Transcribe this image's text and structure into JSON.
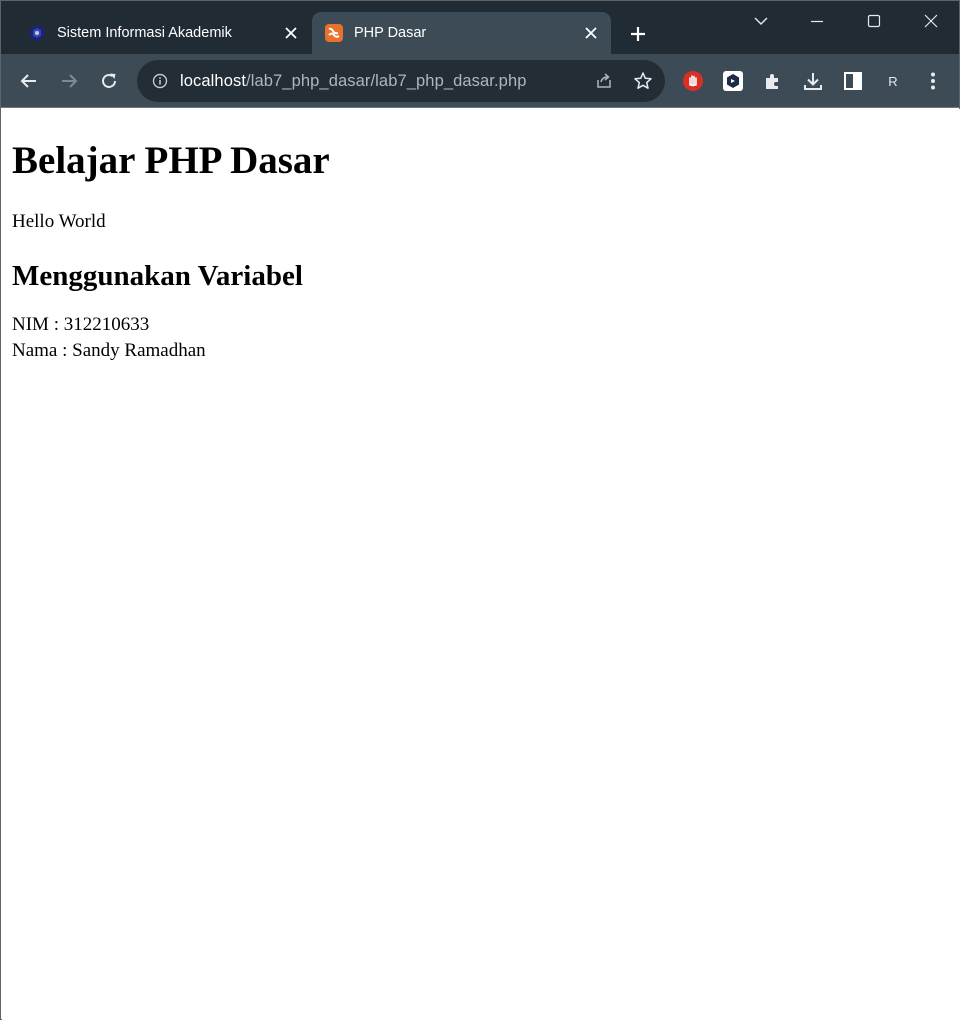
{
  "browser": {
    "tabs": [
      {
        "title": "Sistem Informasi Akademik",
        "favicon": "university-logo-icon",
        "active": false
      },
      {
        "title": "PHP Dasar",
        "favicon": "xampp-logo-icon",
        "active": true
      }
    ],
    "address_bar": {
      "host": "localhost",
      "path": "/lab7_php_dasar/lab7_php_dasar.php"
    },
    "profile_initial": "R",
    "colors": {
      "frame": "#202b34",
      "toolbar": "#3c4b55",
      "omnibox": "#222d36",
      "xampp_orange": "#e8712b",
      "stop_extension_red": "#d93025"
    }
  },
  "page": {
    "heading": "Belajar PHP Dasar",
    "greeting": "Hello World",
    "subheading": "Menggunakan Variabel",
    "nim_line": "NIM : 312210633",
    "nama_line": "Nama : Sandy Ramadhan"
  }
}
